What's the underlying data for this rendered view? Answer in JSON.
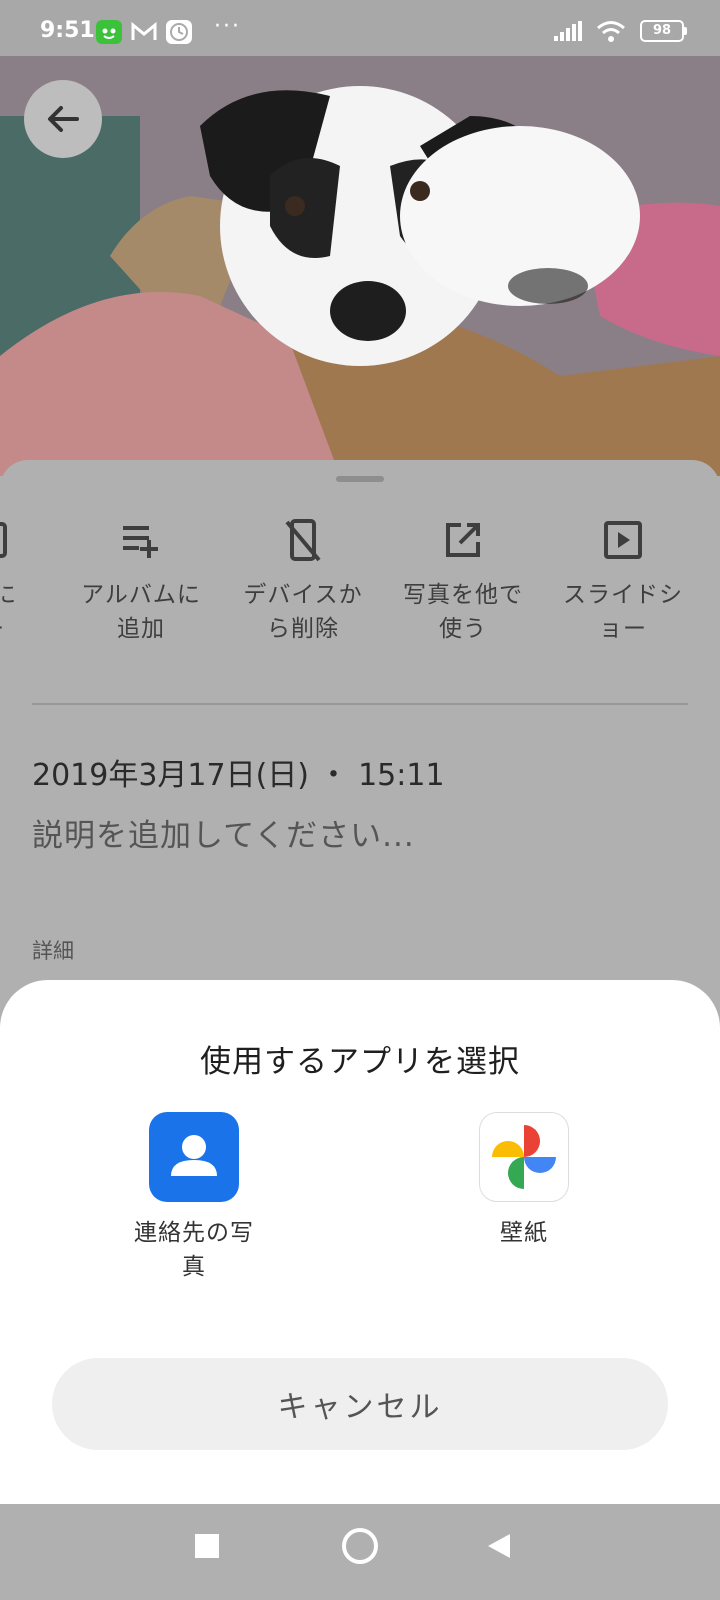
{
  "status_bar": {
    "time": "9:51",
    "battery": "98",
    "more": "···"
  },
  "info_sheet": {
    "actions": [
      {
        "label_line1": "ダに",
        "label_line2": "ー",
        "icon": "folder-icon"
      },
      {
        "label_line1": "アルバムに",
        "label_line2": "追加",
        "icon": "playlist-add-icon"
      },
      {
        "label_line1": "デバイスか",
        "label_line2": "ら削除",
        "icon": "phone-off-icon"
      },
      {
        "label_line1": "写真を他で",
        "label_line2": "使う",
        "icon": "open-in-new-icon"
      },
      {
        "label_line1": "スライドシ",
        "label_line2": "ョー",
        "icon": "slideshow-icon"
      }
    ],
    "date": "2019年3月17日(日) ・ 15:11",
    "description_placeholder": "説明を追加してください...",
    "details_label": "詳細"
  },
  "chooser": {
    "title": "使用するアプリを選択",
    "apps": [
      {
        "label_line1": "連絡先の写",
        "label_line2": "真",
        "icon": "contacts-icon",
        "color": "#1a73e8"
      },
      {
        "label_line1": "壁紙",
        "label_line2": "",
        "icon": "google-photos-icon"
      }
    ],
    "cancel_label": "キャンセル"
  },
  "colors": {
    "dim_background": "#b0b0b0",
    "sheet_background": "#ffffff",
    "cancel_background": "#efefef"
  }
}
